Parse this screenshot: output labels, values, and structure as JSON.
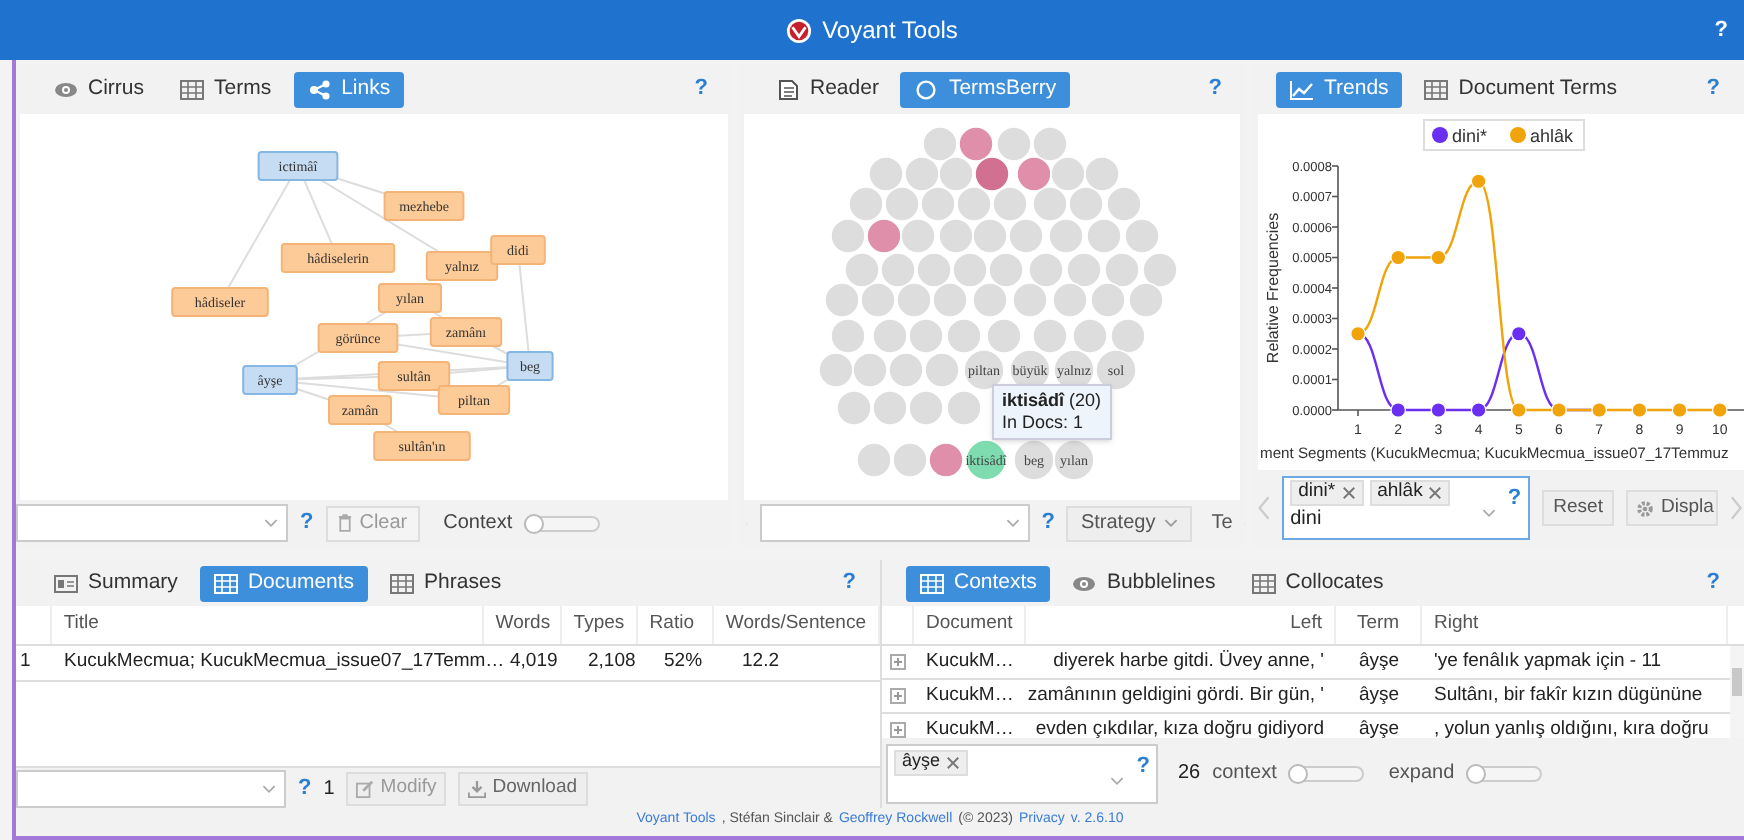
{
  "header": {
    "title": "Voyant Tools",
    "help": "?"
  },
  "links_panel": {
    "tabs": [
      {
        "label": "Cirrus",
        "selected": false
      },
      {
        "label": "Terms",
        "selected": false
      },
      {
        "label": "Links",
        "selected": true
      }
    ],
    "help": "?",
    "nodes": [
      {
        "label": "ictimâî",
        "kind": "keyword"
      },
      {
        "label": "mezhebe",
        "kind": "context"
      },
      {
        "label": "hâdiselerin",
        "kind": "context"
      },
      {
        "label": "yalnız",
        "kind": "context"
      },
      {
        "label": "didi",
        "kind": "context"
      },
      {
        "label": "hâdiseler",
        "kind": "context"
      },
      {
        "label": "yılan",
        "kind": "context"
      },
      {
        "label": "zamânı",
        "kind": "context"
      },
      {
        "label": "görünce",
        "kind": "context"
      },
      {
        "label": "beg",
        "kind": "keyword"
      },
      {
        "label": "âyşe",
        "kind": "keyword"
      },
      {
        "label": "sultân",
        "kind": "context"
      },
      {
        "label": "piltan",
        "kind": "context"
      },
      {
        "label": "zamân",
        "kind": "context"
      },
      {
        "label": "sultân'ın",
        "kind": "context"
      }
    ],
    "toolbar": {
      "help": "?",
      "clear": "Clear",
      "context_label": "Context",
      "context_slider": {
        "level": 0
      }
    }
  },
  "termsberry_panel": {
    "tabs": [
      {
        "label": "Reader",
        "selected": false
      },
      {
        "label": "TermsBerry",
        "selected": true
      }
    ],
    "help": "?",
    "bubbles": [
      {
        "color": "#dddddd"
      },
      {
        "color": "#e08fab"
      },
      {
        "color": "#dddddd"
      },
      {
        "color": "#dddddd"
      },
      {
        "color": "#dddddd"
      },
      {
        "color": "#dddddd"
      },
      {
        "color": "#dddddd"
      },
      {
        "color": "#d17090"
      },
      {
        "color": "#e08fab"
      },
      {
        "color": "#dddddd"
      },
      {
        "color": "#dddddd"
      },
      {
        "color": "#dddddd"
      },
      {
        "color": "#dddddd"
      },
      {
        "color": "#dddddd"
      },
      {
        "color": "#dddddd"
      },
      {
        "color": "#dddddd"
      },
      {
        "color": "#dddddd"
      },
      {
        "color": "#dddddd"
      },
      {
        "color": "#dddddd"
      },
      {
        "color": "#dddddd"
      },
      {
        "color": "#e08fab"
      },
      {
        "color": "#dddddd"
      },
      {
        "color": "#dddddd"
      },
      {
        "color": "#dddddd"
      },
      {
        "color": "#dddddd"
      },
      {
        "color": "#dddddd"
      },
      {
        "color": "#dddddd"
      },
      {
        "color": "#dddddd"
      },
      {
        "color": "#dddddd"
      },
      {
        "color": "#dddddd"
      },
      {
        "color": "#dddddd"
      },
      {
        "color": "#dddddd"
      },
      {
        "color": "#dddddd"
      },
      {
        "color": "#dddddd"
      },
      {
        "color": "#dddddd"
      },
      {
        "color": "#dddddd"
      },
      {
        "color": "#dddddd"
      },
      {
        "color": "#dddddd"
      },
      {
        "color": "#dddddd"
      },
      {
        "color": "#dddddd"
      },
      {
        "color": "#dddddd"
      },
      {
        "color": "#dddddd"
      },
      {
        "color": "#dddddd"
      },
      {
        "color": "#dddddd"
      },
      {
        "color": "#dddddd"
      },
      {
        "color": "#dddddd"
      },
      {
        "color": "#dddddd"
      },
      {
        "color": "#dddddd"
      },
      {
        "color": "#dddddd"
      },
      {
        "color": "#dddddd"
      },
      {
        "color": "#dddddd"
      },
      {
        "color": "#dddddd"
      },
      {
        "color": "#dddddd"
      },
      {
        "color": "#dddddd"
      },
      {
        "color": "#dddddd"
      },
      {
        "color": "#dddddd"
      },
      {
        "color": "#dddddd"
      },
      {
        "color": "#dddddd"
      },
      {
        "color": "#dddddd",
        "label": "piltan"
      },
      {
        "color": "#dddddd",
        "label": "büyük"
      },
      {
        "color": "#dddddd",
        "label": "yalnız"
      },
      {
        "color": "#dddddd",
        "label": "sol"
      },
      {
        "color": "#dddddd"
      },
      {
        "color": "#dddddd"
      },
      {
        "color": "#dddddd"
      },
      {
        "color": "#dddddd"
      },
      {
        "color": "#dddddd"
      },
      {
        "color": "#dddddd"
      },
      {
        "color": "#e08fab"
      },
      {
        "color": "#7fdcb0",
        "label": "iktisâdî"
      },
      {
        "color": "#dddddd",
        "label": "beg"
      },
      {
        "color": "#dddddd",
        "label": "yılan"
      }
    ],
    "tooltip": {
      "term": "**iktisâdî** (20)",
      "docs": "In Docs: 1"
    },
    "toolbar": {
      "help": "?",
      "strategy": "Strategy",
      "next_tab": "Te"
    }
  },
  "trends_panel": {
    "tabs": [
      {
        "label": "Trends",
        "selected": true
      },
      {
        "label": "Document Terms",
        "selected": false
      }
    ],
    "help": "?",
    "chart_data": {
      "type": "line",
      "xlabel": "ment Segments (KucukMecmua; KucukMecmua_issue07_17Temmuz",
      "ylabel": "Relative Frequencies",
      "legend": true,
      "categories": [
        "1",
        "2",
        "3",
        "4",
        "5",
        "6",
        "7",
        "8",
        "9",
        "10"
      ],
      "series": [
        {
          "name": "dini*",
          "color": "#6a2ff0",
          "marker": "circle",
          "values": [
            0.00025,
            0,
            0,
            0,
            0.00025,
            0,
            0,
            null,
            null,
            null
          ]
        },
        {
          "name": "ahlâk",
          "color": "#f0a30a",
          "marker": "circle",
          "values": [
            0.00025,
            0.0005,
            0.0005,
            0.00075,
            0,
            0,
            0,
            0,
            0,
            0
          ]
        }
      ],
      "ylim": [
        0,
        0.0008
      ],
      "yticks": [
        {
          "value": 0,
          "label": "0.0000"
        },
        {
          "value": 0.0001,
          "label": "0.0001"
        },
        {
          "value": 0.0002,
          "label": "0.0002"
        },
        {
          "value": 0.0003,
          "label": "0.0003"
        },
        {
          "value": 0.0004,
          "label": "0.0004"
        },
        {
          "value": 0.0005,
          "label": "0.0005"
        },
        {
          "value": 0.0006,
          "label": "0.0006"
        },
        {
          "value": 0.0007,
          "label": "0.0007"
        },
        {
          "value": 0.0008,
          "label": "0.0008"
        }
      ]
    },
    "query": {
      "tags": [
        "dini*",
        "ahlâk"
      ],
      "value": "dini",
      "help": "?"
    },
    "reset": "Reset",
    "display": "Displa"
  },
  "documents_panel": {
    "tabs": [
      {
        "label": "Summary",
        "selected": false
      },
      {
        "label": "Documents",
        "selected": true
      },
      {
        "label": "Phrases",
        "selected": false
      }
    ],
    "help": "?",
    "table": {
      "columns": [
        "",
        "Title",
        "Words",
        "Types",
        "Ratio",
        "Words/Sentence"
      ],
      "rows": [
        [
          "1",
          "KucukMecmua; KucukMecmua_issue07_17Temm…",
          "4,019",
          "2,108",
          "52%",
          "12.2"
        ]
      ]
    },
    "toolbar": {
      "help": "?",
      "count": "1",
      "modify": "Modify",
      "download": "Download"
    }
  },
  "contexts_panel": {
    "tabs": [
      {
        "label": "Contexts",
        "selected": true
      },
      {
        "label": "Bubblelines",
        "selected": false
      },
      {
        "label": "Collocates",
        "selected": false
      }
    ],
    "help": "?",
    "table": {
      "columns": [
        "",
        "Document",
        "Left",
        "Term",
        "Right"
      ],
      "rows": [
        [
          "",
          "KucukM…",
          "diyerek harbe gitdi. Üvey anne, '",
          "âyşe",
          "'ye fenâlık yapmak için - 11"
        ],
        [
          "",
          "KucukM…",
          "zamânının geldigini gördi. Bir gün, '",
          "âyşe",
          "Sultânı, bir fakîr kızın dügününe"
        ],
        [
          "",
          "KucukM…",
          "evden çıkdılar, kıza doğru gidiyord",
          "âyşe",
          ", yolun yanlış oldığını, kıra doğru"
        ]
      ]
    },
    "toolbar": {
      "tags": [
        "âyşe"
      ],
      "help": "?",
      "count": "26",
      "context_label": "context",
      "context_slider": {
        "level": 0
      },
      "expand_label": "expand",
      "expand_slider": {
        "level": 0
      }
    }
  },
  "footer": [
    {
      "text": "Voyant Tools",
      "link": true
    },
    {
      "text": ", Stéfan Sinclair &",
      "link": false
    },
    {
      "text": "Geoffrey Rockwell",
      "link": true
    },
    {
      "text": "(© 2023)",
      "link": false
    },
    {
      "text": "Privacy",
      "link": true
    },
    {
      "text": "v. 2.6.10",
      "link": true
    }
  ]
}
